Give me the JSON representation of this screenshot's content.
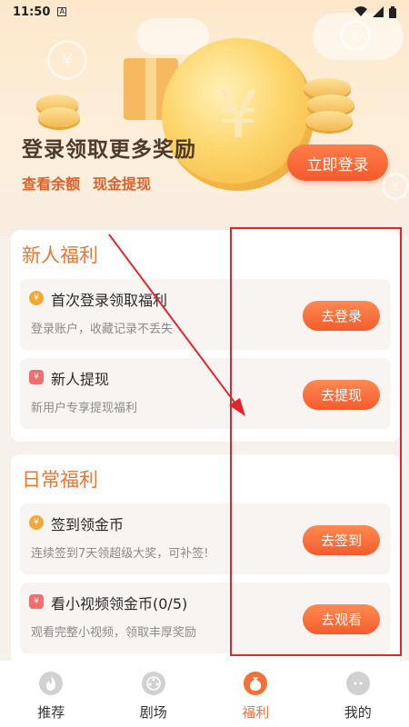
{
  "status_bar": {
    "time": "11:50",
    "notification": "A"
  },
  "header": {
    "title": "登录领取更多奖励",
    "links": [
      "查看余额",
      "现金提现"
    ],
    "login_button": "立即登录",
    "coin_symbol": "¥"
  },
  "sections": [
    {
      "title": "新人福利",
      "tasks": [
        {
          "icon": "coin-icon",
          "title": "首次登录领取福利",
          "desc": "登录账户，收藏记录不丢失",
          "button": "去登录"
        },
        {
          "icon": "cash-icon",
          "title": "新人提现",
          "desc": "新用户专享提现福利",
          "button": "去提现"
        }
      ]
    },
    {
      "title": "日常福利",
      "tasks": [
        {
          "icon": "coin-icon",
          "title": "签到领金币",
          "desc": "连续签到7天领超级大奖，可补签!",
          "button": "去签到"
        },
        {
          "icon": "cash-icon",
          "title": "看小视频领金币(0/5)",
          "desc": "观看完整小视频，领取丰厚奖励",
          "button": "去观看"
        }
      ]
    }
  ],
  "bottom_nav": [
    {
      "label": "推荐",
      "icon": "flame-icon",
      "active": false
    },
    {
      "label": "剧场",
      "icon": "film-reel-icon",
      "active": false
    },
    {
      "label": "福利",
      "icon": "money-bag-icon",
      "active": true
    },
    {
      "label": "我的",
      "icon": "profile-icon",
      "active": false
    }
  ],
  "colors": {
    "accent": "#f1713a",
    "button": "#f45c2d",
    "annotation": "#e0262c"
  }
}
